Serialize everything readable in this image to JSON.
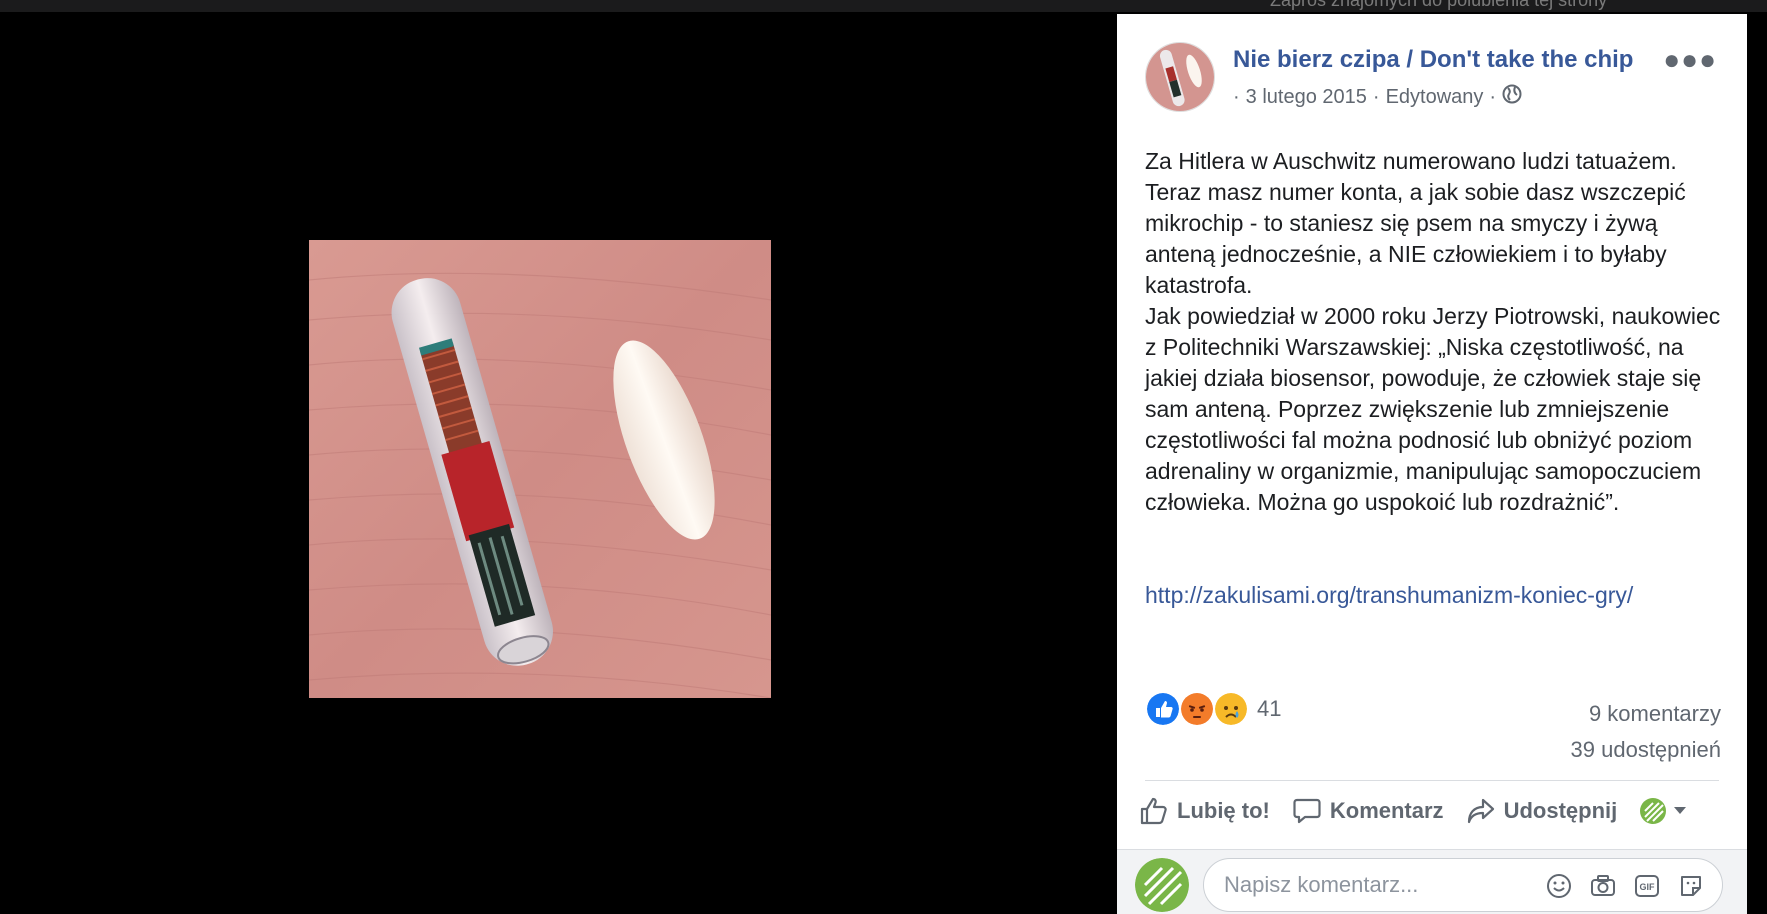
{
  "top_strip": {
    "text": "Zaproś znajomych do polubienia tej strony"
  },
  "post": {
    "page_name": "Nie bierz czipa / Don't take the chip",
    "date": "3 lutego 2015",
    "edited": "Edytowany",
    "separator": "·",
    "text": "Za Hitlera w Auschwitz numerowano ludzi tatuażem. Teraz masz numer konta, a jak sobie dasz wszczepić mikrochip - to staniesz się psem na smyczy i żywą anteną jednocześnie, a NIE człowiekiem i to byłaby katastrofa.\nJak powiedział w 2000 roku Jerzy Piotrowski, naukowiec z Politechniki Warszawskiej: „Niska częstotliwość, na jakiej działa biosensor, powoduje, że człowiek staje się sam anteną. Poprzez zwiększenie lub zmniejszenie częstotliwości fal można podnosić lub obniżyć poziom adrenaliny w organizmie, manipulując samopoczuciem człowieka. Można go uspokoić lub rozdrażnić”.",
    "link": "http://zakulisami.org/transhumanizm-koniec-gry/",
    "reaction_count": "41",
    "comments_count": "9 komentarzy",
    "shares_count": "39 udostępnień"
  },
  "actions": {
    "like": "Lubię to!",
    "comment": "Komentarz",
    "share": "Udostępnij"
  },
  "composer": {
    "placeholder": "Napisz komentarz..."
  },
  "colors": {
    "link_blue": "#385898",
    "like_blue": "#1877f2",
    "angry_orange": "#f15b2b",
    "sad_yellow": "#f7b928"
  }
}
